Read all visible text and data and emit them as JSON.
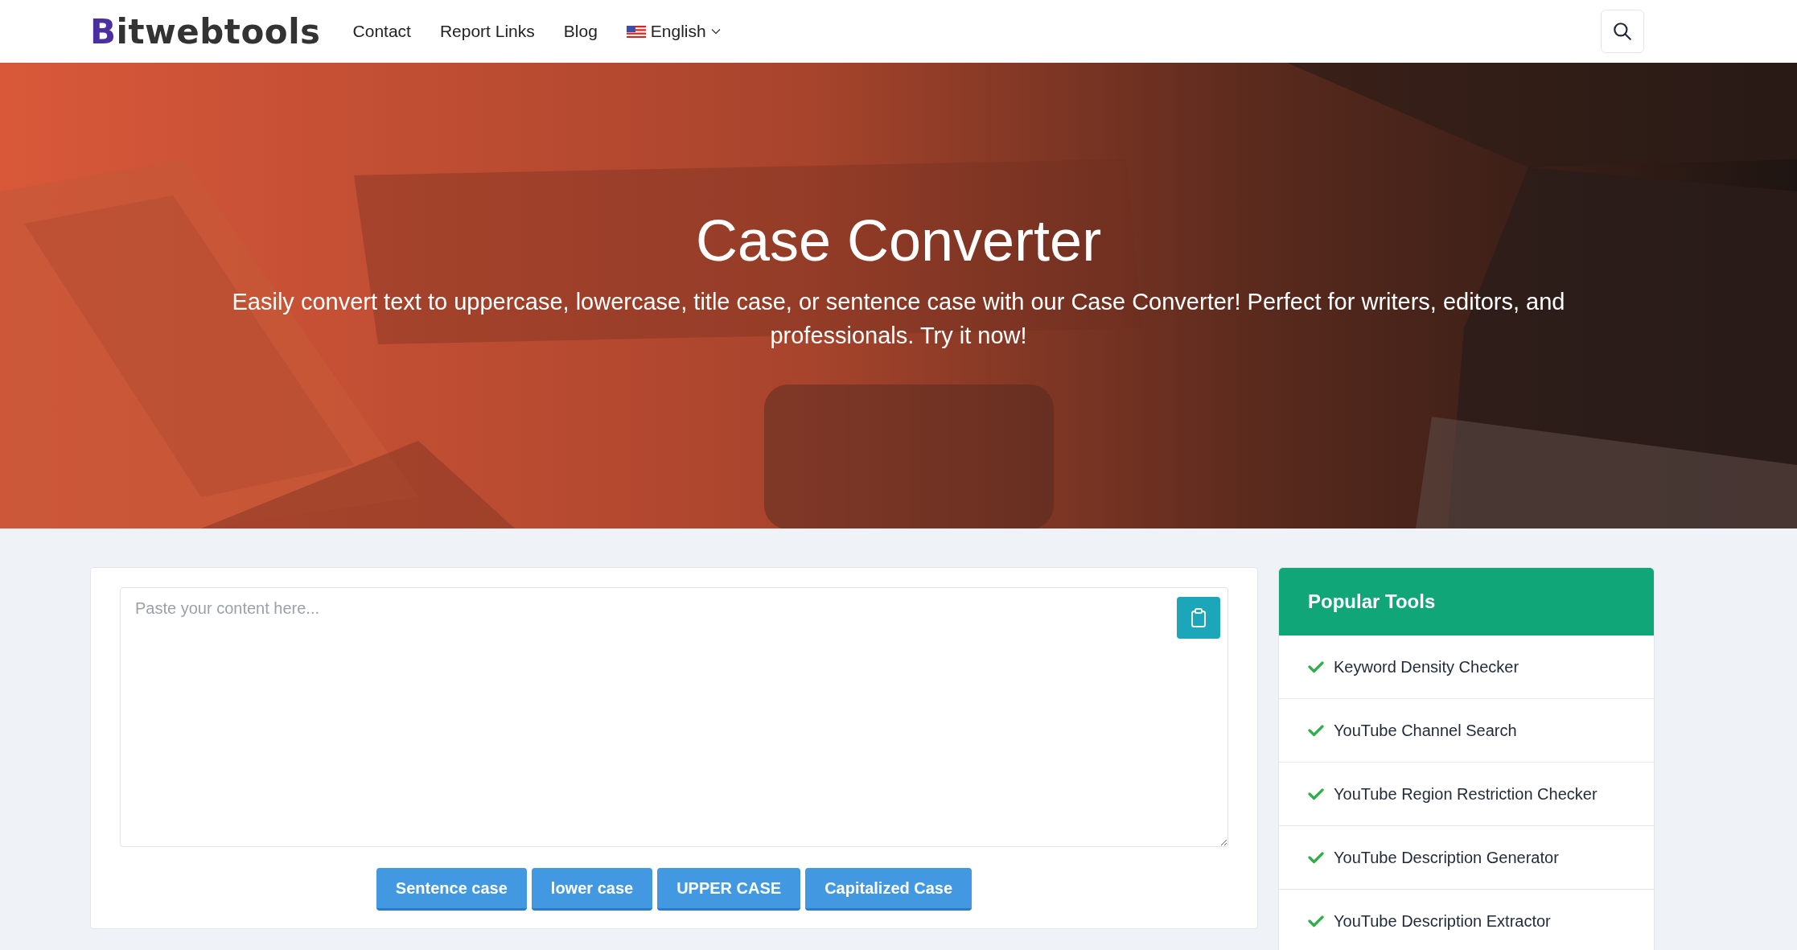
{
  "header": {
    "logo": "Bitwebtools",
    "nav": [
      {
        "label": "Contact"
      },
      {
        "label": "Report Links"
      },
      {
        "label": "Blog"
      }
    ],
    "language": {
      "label": "English"
    }
  },
  "hero": {
    "kind": "picture",
    "title": "Case Converter",
    "subtitle": "Easily convert text to uppercase, lowercase, title case, or sentence case with our Case Converter! Perfect for writers, editors, and professionals. Try it now!"
  },
  "editor": {
    "placeholder": "Paste your content here...",
    "buttons": [
      {
        "label": "Sentence case"
      },
      {
        "label": "lower case"
      },
      {
        "label": "UPPER CASE"
      },
      {
        "label": "Capitalized Case"
      }
    ]
  },
  "sidebar": {
    "title": "Popular Tools",
    "items": [
      {
        "label": "Keyword Density Checker"
      },
      {
        "label": "YouTube Channel Search"
      },
      {
        "label": "YouTube Region Restriction Checker"
      },
      {
        "label": "YouTube Description Generator"
      },
      {
        "label": "YouTube Description Extractor"
      }
    ]
  }
}
